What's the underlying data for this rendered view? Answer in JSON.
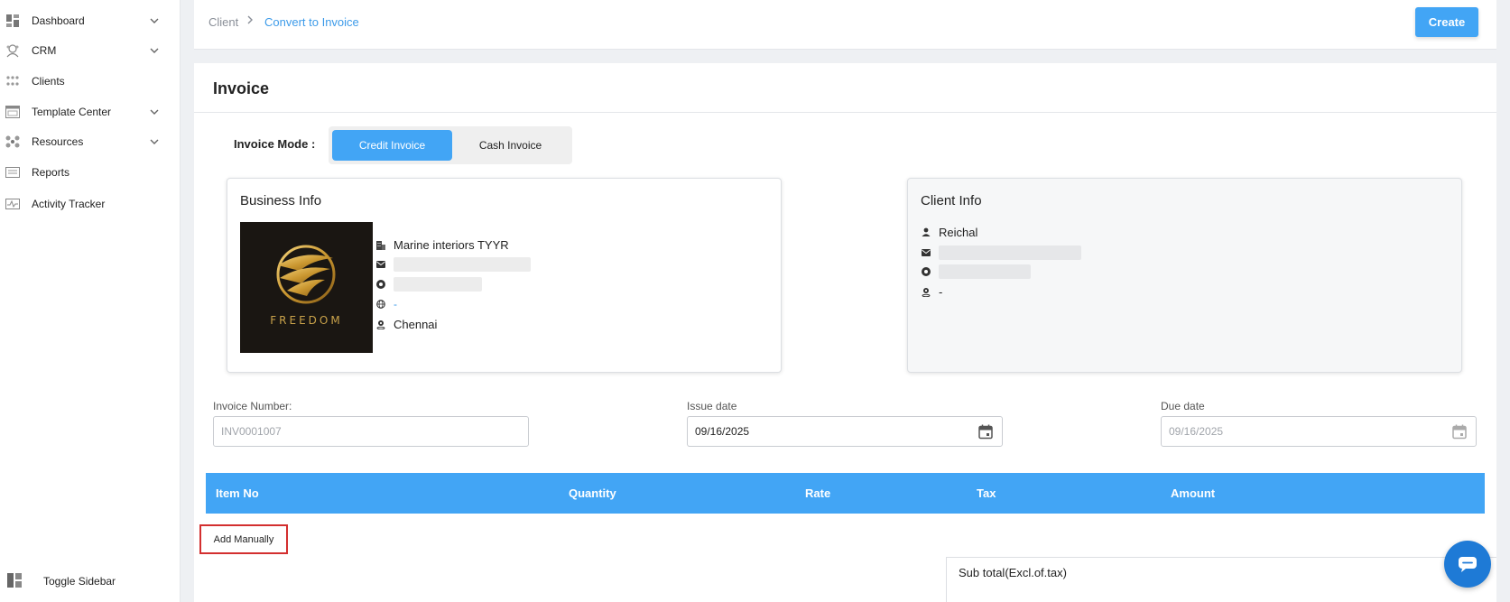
{
  "sidebar": {
    "items": [
      {
        "label": "Dashboard",
        "icon": "dashboard-icon",
        "has_chevron": true
      },
      {
        "label": "CRM",
        "icon": "crm-icon",
        "has_chevron": true
      },
      {
        "label": "Clients",
        "icon": "clients-icon",
        "has_chevron": false
      },
      {
        "label": "Template Center",
        "icon": "template-icon",
        "has_chevron": true
      },
      {
        "label": "Resources",
        "icon": "resources-icon",
        "has_chevron": true
      },
      {
        "label": "Reports",
        "icon": "reports-icon",
        "has_chevron": false
      },
      {
        "label": "Activity Tracker",
        "icon": "activity-icon",
        "has_chevron": false
      }
    ],
    "toggle_label": "Toggle Sidebar"
  },
  "breadcrumb": {
    "parent": "Client",
    "current": "Convert to Invoice"
  },
  "header": {
    "create_label": "Create"
  },
  "invoice": {
    "title": "Invoice",
    "mode_label": "Invoice Mode :",
    "modes": [
      "Credit Invoice",
      "Cash Invoice"
    ],
    "selected_mode": "Credit Invoice"
  },
  "business_info": {
    "title": "Business Info",
    "logo_text": "FREEDOM",
    "name": "Marine interiors TYYR",
    "website": "-",
    "location": "Chennai"
  },
  "client_info": {
    "title": "Client Info",
    "name": "Reichal",
    "location": "-"
  },
  "fields": {
    "invoice_number": {
      "label": "Invoice Number:",
      "placeholder": "INV0001007"
    },
    "issue_date": {
      "label": "Issue date",
      "value": "09/16/2025"
    },
    "due_date": {
      "label": "Due date",
      "placeholder": "09/16/2025"
    }
  },
  "table": {
    "columns": [
      "Item No",
      "Quantity",
      "Rate",
      "Tax",
      "Amount"
    ],
    "add_manually_label": "Add Manually"
  },
  "totals": {
    "subtotal_label": "Sub total(Excl.of.tax)"
  },
  "colors": {
    "accent": "#42a5f5",
    "link": "#3d9be9",
    "highlight": "#d32f2f"
  }
}
